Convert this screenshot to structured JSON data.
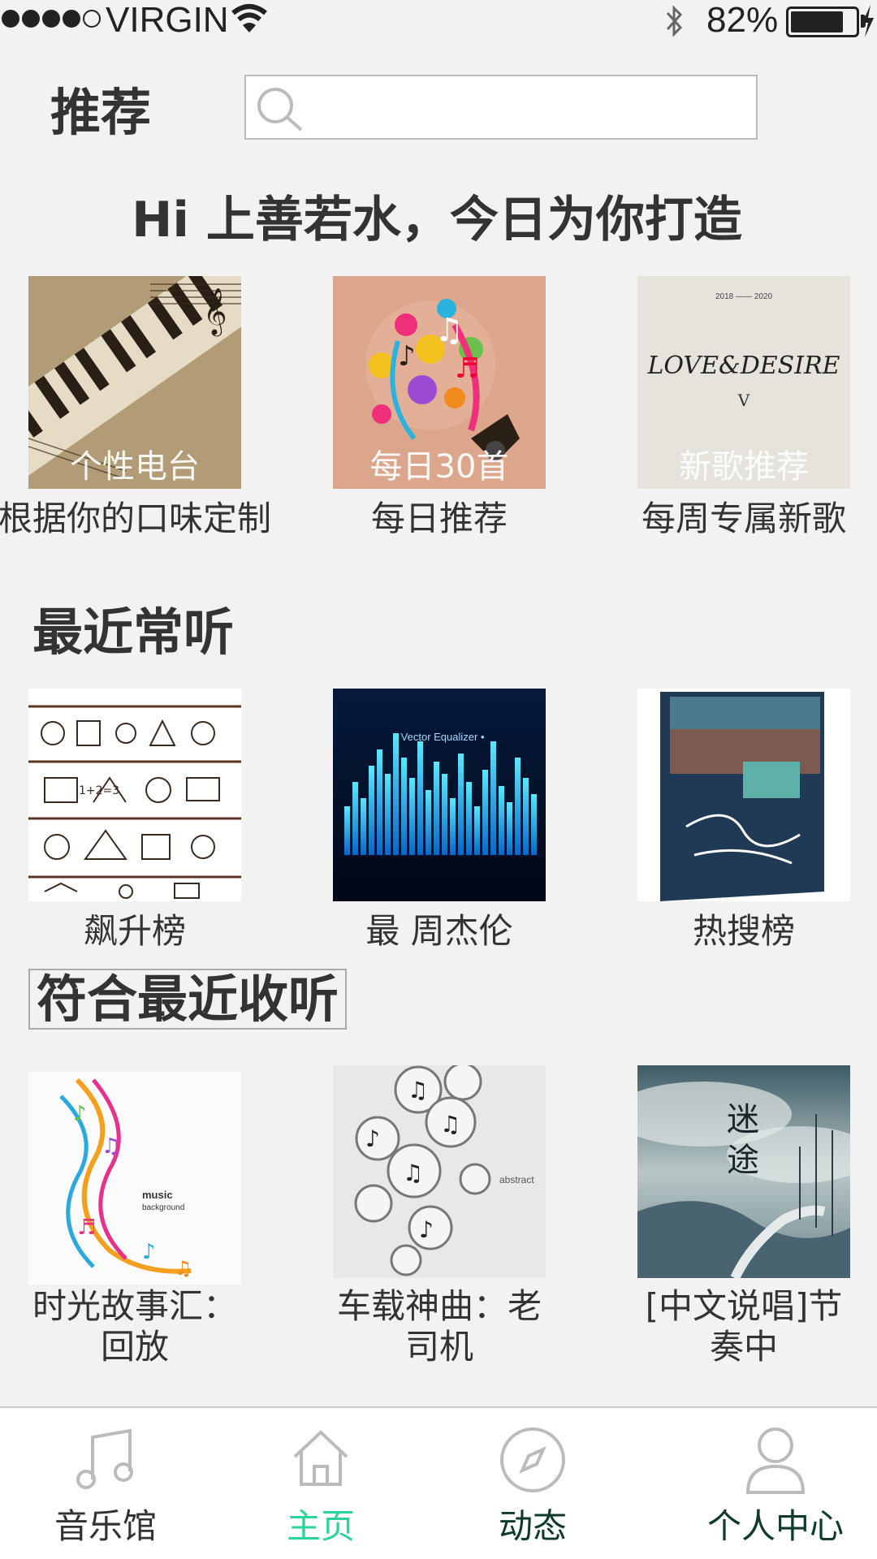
{
  "status_bar": {
    "carrier": "VIRGIN",
    "battery": "82%",
    "battery_level": 0.82
  },
  "header": {
    "title": "推荐",
    "search_placeholder": ""
  },
  "greeting": "Hi 上善若水，今日为你打造",
  "recommend": {
    "items": [
      {
        "overlay": "个性电台",
        "label": "根据你的口味定制"
      },
      {
        "overlay": "每日30首",
        "label": "每日推荐"
      },
      {
        "overlay": "新歌推荐",
        "label": "每周专属新歌"
      }
    ],
    "cover3_text": {
      "years": "2018 —— 2020",
      "title": "LOVE&DESIRE",
      "sub": "V"
    }
  },
  "recent": {
    "title": "最近常听",
    "items": [
      {
        "label": "飙升榜"
      },
      {
        "label": "最 周杰伦"
      },
      {
        "label": "热搜榜"
      }
    ],
    "cover2_text": "• Vector Equalizer •"
  },
  "suggested": {
    "title": "符合最近收听",
    "items": [
      {
        "label_line1": "时光故事汇：",
        "label_line2": "回放"
      },
      {
        "label_line1": "车载神曲：老",
        "label_line2": "司机"
      },
      {
        "label_line1": "[中文说唱]节",
        "label_line2": "奏中"
      }
    ],
    "cover1_text": {
      "line1": "music",
      "line2": "background"
    },
    "cover2_text": "abstract",
    "cover3_text": {
      "line1": "迷",
      "line2": "途"
    }
  },
  "tab_bar": {
    "tabs": [
      {
        "label": "音乐馆",
        "icon": "music-note-icon",
        "color": "#333333"
      },
      {
        "label": "主页",
        "icon": "home-icon",
        "color": "#2dd49a",
        "active": true
      },
      {
        "label": "动态",
        "icon": "compass-icon",
        "color": "#0e3b2c"
      },
      {
        "label": "个人中心",
        "icon": "person-icon",
        "color": "#0e3b2c"
      }
    ]
  },
  "colors": {
    "background": "#f2f2f2",
    "accent": "#2dd49a"
  }
}
